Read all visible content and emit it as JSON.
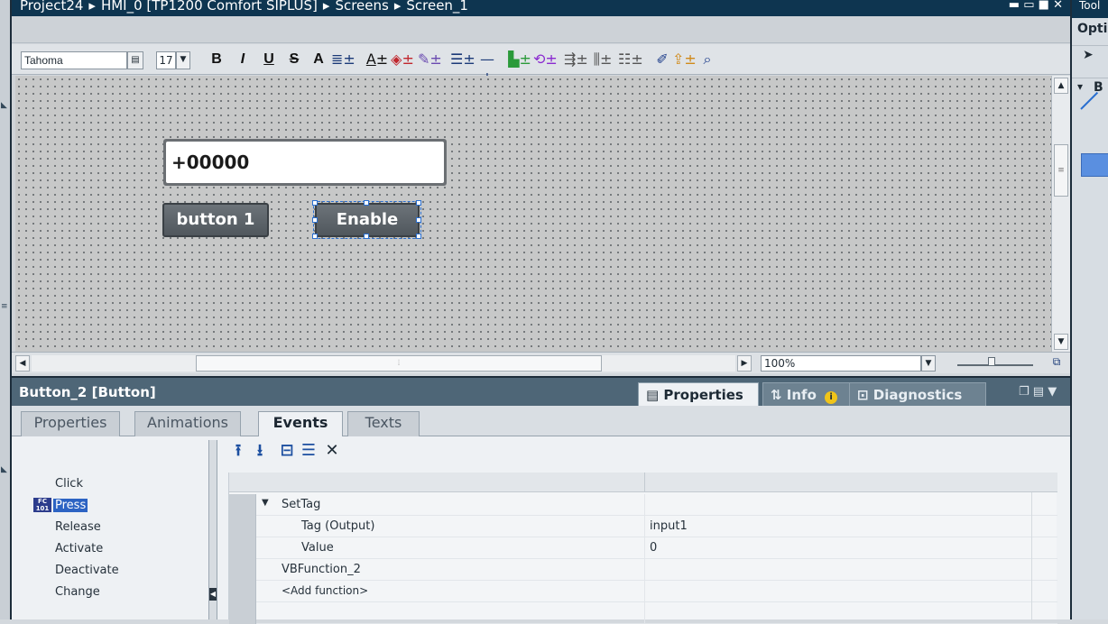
{
  "titlebar": {
    "crumbs": [
      "Project24",
      "HMI_0 [TP1200 Comfort SIPLUS]",
      "Screens",
      "Screen_1"
    ],
    "separator": "▸"
  },
  "right_panel": {
    "title": "Tool",
    "options_label": "Opti",
    "section_label": "B"
  },
  "toolbar": {
    "font_name": "Tahoma",
    "font_size": "17",
    "bold": "B",
    "italic": "I",
    "underline": "U",
    "strike": "S",
    "superscript": "A"
  },
  "canvas": {
    "io_field_value": "+00000",
    "button1_label": "button 1",
    "button2_label": "Enable"
  },
  "zoom": {
    "value": "100%"
  },
  "inspector": {
    "title": "Button_2 [Button]",
    "tabs": {
      "properties": "Properties",
      "info": "Info",
      "diagnostics": "Diagnostics"
    },
    "subtabs": [
      "Properties",
      "Animations",
      "Events",
      "Texts"
    ]
  },
  "events": {
    "items": [
      "Click",
      "Press",
      "Release",
      "Activate",
      "Deactivate",
      "Change"
    ],
    "selected": "Press",
    "functions": {
      "function_name": "SetTag",
      "param1_name": "Tag (Output)",
      "param1_value": "input1",
      "param2_name": "Value",
      "param2_value": "0",
      "function2_name": "VBFunction_2",
      "add_function": "<Add function>"
    }
  },
  "colors": {
    "title_bar": "#0e3550",
    "inspector_header": "#4e6677",
    "selection": "#2c63c3",
    "hmi_button": "#5f666c"
  }
}
